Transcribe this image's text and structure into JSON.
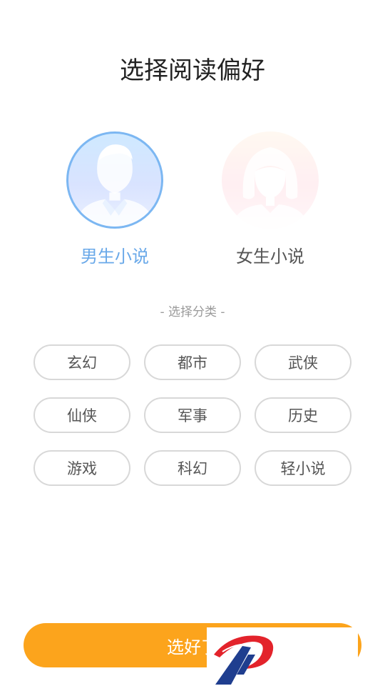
{
  "page": {
    "title": "选择阅读偏好"
  },
  "genders": {
    "male": {
      "label": "男生小说",
      "selected": true
    },
    "female": {
      "label": "女生小说",
      "selected": false
    }
  },
  "categories": {
    "section_label": "- 选择分类 -",
    "items": [
      "玄幻",
      "都市",
      "武侠",
      "仙侠",
      "军事",
      "历史",
      "游戏",
      "科幻",
      "轻小说"
    ]
  },
  "confirm": {
    "label": "选好了"
  },
  "colors": {
    "accent_blue": "#6aa9e9",
    "button_orange": "#fca41c",
    "chip_border": "#d8d8d8"
  }
}
